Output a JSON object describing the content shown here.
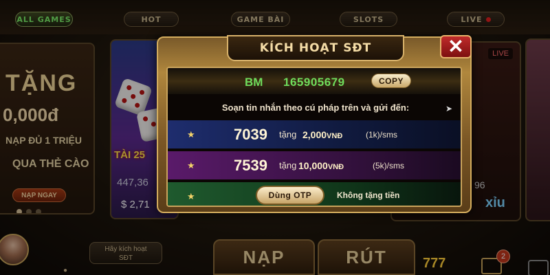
{
  "tabs": {
    "all_games": "ALL GAMES",
    "hot": "HOT",
    "game_bai": "GAME BÀI",
    "slots": "SLOTS",
    "live": "LIVE"
  },
  "promo": {
    "line1": "TẶNG",
    "line2": "0,000đ",
    "line3": "NẠP ĐỦ 1 TRIỆU",
    "line4": "QUA THẺ CÀO",
    "button": "NẠP NGAY"
  },
  "game_left": {
    "label": "TÀI 25",
    "num1": "447,36",
    "num2": "$ 2,71"
  },
  "game_right": {
    "live_badge": "LIVE",
    "num": "96",
    "xiu": "xỉu"
  },
  "modal": {
    "title": "KÍCH HOẠT SĐT",
    "code_prefix": "BM",
    "code_value": "165905679",
    "copy_label": "COPY",
    "instruction": "Soạn tin nhắn theo cú pháp trên và gửi đến:",
    "options": [
      {
        "code": "7039",
        "tang": "tặng",
        "amount": "2,000",
        "currency": "VNĐ",
        "rate": "(1k)/sms"
      },
      {
        "code": "7539",
        "tang": "tặng",
        "amount": "10,000",
        "currency": "VNĐ",
        "rate": "(5k)/sms"
      }
    ],
    "otp_button": "Dùng OTP",
    "no_gift": "Không tặng tiền"
  },
  "bottom": {
    "activate_line1": "Hãy kích hoạt",
    "activate_line2": "SĐT",
    "nap": "NẠP",
    "rut": "RÚT",
    "badge": "2",
    "slot_icon_text": "777"
  }
}
